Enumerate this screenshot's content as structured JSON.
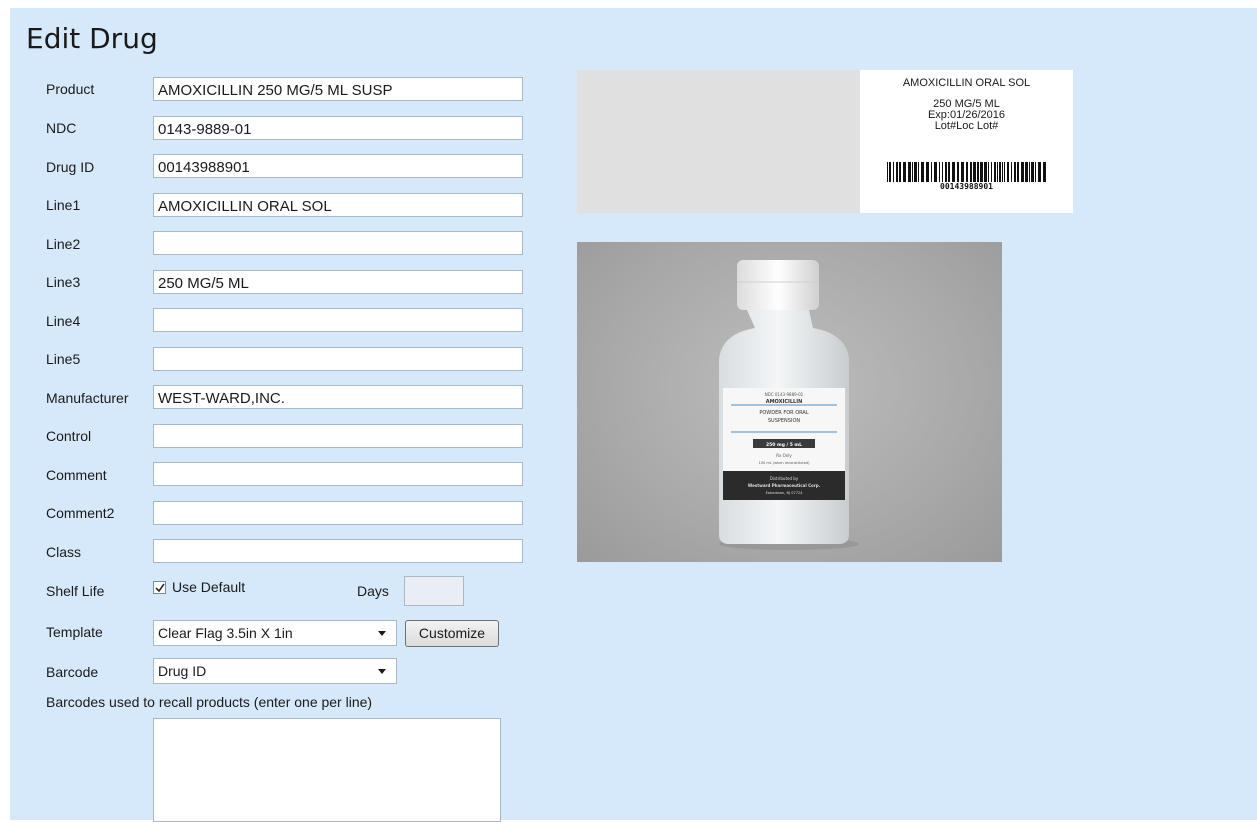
{
  "page": {
    "title": "Edit Drug"
  },
  "form": {
    "product": {
      "label": "Product",
      "value": "AMOXICILLIN 250 MG/5 ML SUSP"
    },
    "ndc": {
      "label": "NDC",
      "value": "0143-9889-01"
    },
    "drug_id": {
      "label": "Drug ID",
      "value": "00143988901"
    },
    "line1": {
      "label": "Line1",
      "value": "AMOXICILLIN ORAL SOL"
    },
    "line2": {
      "label": "Line2",
      "value": ""
    },
    "line3": {
      "label": "Line3",
      "value": "250 MG/5 ML"
    },
    "line4": {
      "label": "Line4",
      "value": ""
    },
    "line5": {
      "label": "Line5",
      "value": ""
    },
    "manufacturer": {
      "label": "Manufacturer",
      "value": "WEST-WARD,INC."
    },
    "control": {
      "label": "Control",
      "value": ""
    },
    "comment": {
      "label": "Comment",
      "value": ""
    },
    "comment2": {
      "label": "Comment2",
      "value": ""
    },
    "class": {
      "label": "Class",
      "value": ""
    },
    "shelf_life": {
      "label": "Shelf Life",
      "use_default_label": "Use Default",
      "use_default_checked": true,
      "days_label": "Days",
      "days_value": ""
    },
    "template": {
      "label": "Template",
      "selected": "Clear Flag 3.5in X 1in",
      "customize_label": "Customize"
    },
    "barcode": {
      "label": "Barcode",
      "selected": "Drug ID"
    },
    "recall": {
      "label": "Barcodes used to recall products (enter one per line)",
      "value": ""
    }
  },
  "label_preview": {
    "line1": "AMOXICILLIN ORAL SOL",
    "line3": "250 MG/5 ML",
    "exp": "Exp:01/26/2016",
    "lot": "Lot#Loc Lot#",
    "barcode_text": "00143988901"
  },
  "product_photo": {
    "label_lines": [
      "NDC 0143-9889-01",
      "AMOXICILLIN",
      "POWDER FOR ORAL",
      "SUSPENSION",
      "250 mg / 5 mL",
      "Rx Only",
      "100 mL (when reconstituted)",
      "Distributed by",
      "Westward Pharmaceutical Corp.",
      "Eatontown, NJ 07724"
    ]
  }
}
